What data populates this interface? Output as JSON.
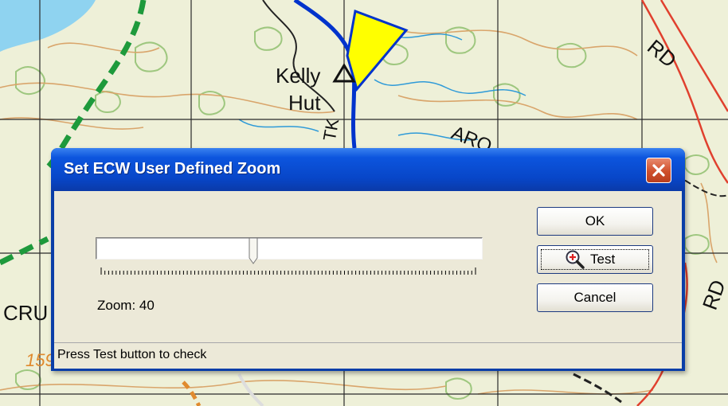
{
  "map": {
    "place_labels": [
      "Kelly",
      "Hut"
    ],
    "road_labels": [
      "RD",
      "RD",
      "ARO",
      "CRU",
      "TK"
    ],
    "spot_height": "159",
    "colors": {
      "background": "#eef0d8",
      "contour": "#d9a56b",
      "vegetation": "#9ec77f",
      "grid": "#2a2a2a",
      "river": "#2e9ad8",
      "track": "#0033cc",
      "green_boundary": "#1e9a3c",
      "red_road": "#e0402e",
      "cursor": "#ffff00"
    }
  },
  "dialog": {
    "title": "Set ECW User Defined Zoom",
    "close_icon": "close-icon",
    "slider": {
      "value": 40,
      "fill_fraction": 0.41
    },
    "zoom_label": "Zoom: 40",
    "buttons": {
      "ok": "OK",
      "test": "Test",
      "cancel": "Cancel"
    },
    "test_icon": "zoom-in-magnifier-icon",
    "status": "Press Test button to check",
    "colors": {
      "title_bar": "#0846c8",
      "client": "#ece9d8",
      "close_button": "#cf4f2c"
    }
  }
}
